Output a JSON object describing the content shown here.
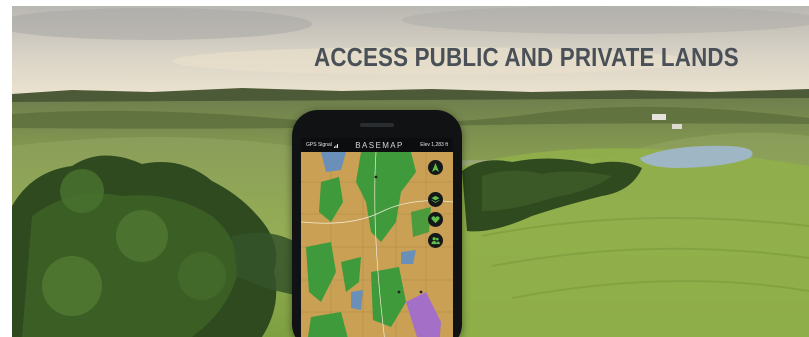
{
  "banner": {
    "headline": "ACCESS PUBLIC AND PRIVATE LANDS"
  },
  "phone": {
    "status": {
      "gps_label": "GPS Signal",
      "app_name": "BASEMAP",
      "elevation": "Elev 1,283 ft"
    },
    "map_buttons": [
      {
        "icon": "navigation-arrow-icon"
      },
      {
        "icon": "layers-icon"
      },
      {
        "icon": "heart-icon"
      },
      {
        "icon": "friends-icon"
      }
    ]
  },
  "colors": {
    "headline": "#4a5058",
    "public_land": "#3e9a3a",
    "private_land": "#c9a054",
    "special_area": "#a36fc7",
    "water": "#6a8fb8"
  }
}
